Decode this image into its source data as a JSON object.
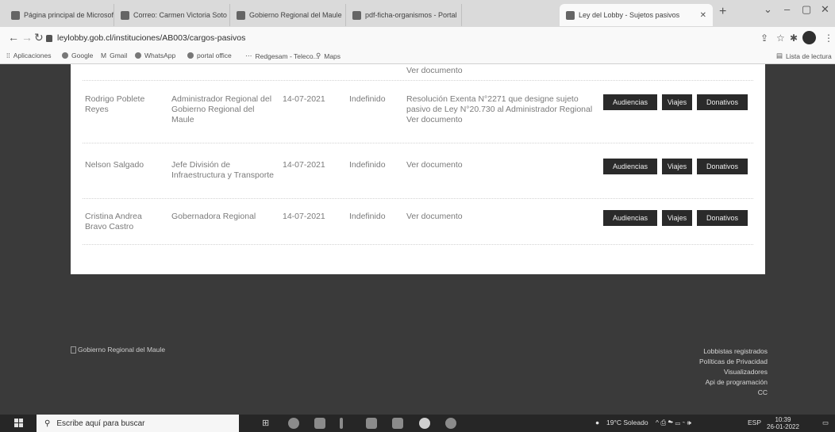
{
  "browser": {
    "tabs": [
      {
        "title": "Página principal de Microsoft",
        "icon": "office-icon"
      },
      {
        "title": "Correo: Carmen Victoria Soto",
        "icon": "outlook-icon"
      },
      {
        "title": "Gobierno Regional del Maule",
        "icon": "region-icon"
      },
      {
        "title": "pdf-ficha-organismos - Portal",
        "icon": "pdf-icon"
      },
      {
        "title": "Ley del Lobby - Sujetos pasivos",
        "icon": "lobby-icon",
        "active": true
      }
    ],
    "url": "leylobby.gob.cl/instituciones/AB003/cargos-pasivos",
    "bookmarks": [
      "Aplicaciones",
      "Google",
      "Gmail",
      "WhatsApp",
      "portal office",
      "Redgesam - Teleco...",
      "Maps"
    ],
    "reading_list": "Lista de lectura"
  },
  "table": {
    "top_partial": "Ver documento",
    "rows": [
      {
        "name": "Rodrigo Poblete Reyes",
        "cargo": "Administrador Regional del Gobierno Regional del Maule",
        "fecha": "14-07-2021",
        "plazo": "Indefinido",
        "resolucion": "Resolución Exenta N°2271 que designe sujeto pasivo de Ley N°20.730 al Administrador Regional Ver documento"
      },
      {
        "name": "Nelson Salgado",
        "cargo": "Jefe División de Infraestructura y Transporte",
        "fecha": "14-07-2021",
        "plazo": "Indefinido",
        "resolucion": "Ver documento"
      },
      {
        "name": "Cristina Andrea Bravo Castro",
        "cargo": "Gobernadora Regional",
        "fecha": "14-07-2021",
        "plazo": "Indefinido",
        "resolucion": "Ver documento"
      }
    ],
    "buttons": {
      "audiencias": "Audiencias",
      "viajes": "Viajes",
      "donativos": "Donativos"
    }
  },
  "footer": {
    "logo_alt": "Gobierno Regional del Maule",
    "links": [
      "Lobbistas registrados",
      "Políticas de Privacidad",
      "Visualizadores",
      "Api de programación",
      "CC"
    ]
  },
  "taskbar": {
    "search_placeholder": "Escribe aquí para buscar",
    "weather": "19°C Soleado",
    "language": "ESP",
    "time": "10:39",
    "date": "26-01-2022"
  }
}
